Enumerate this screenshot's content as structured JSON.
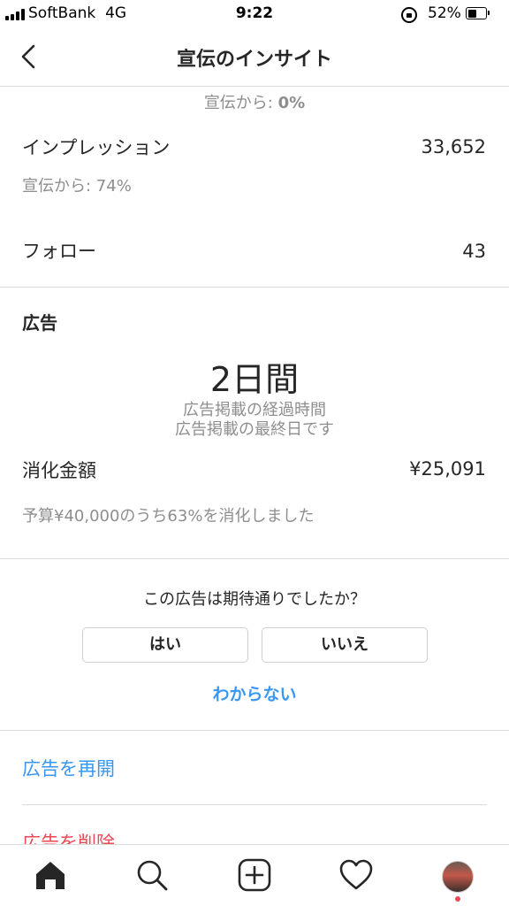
{
  "status_bar": {
    "carrier": "SoftBank",
    "network": "4G",
    "time": "9:22",
    "battery_percent": "52%",
    "battery_level": 0.52
  },
  "header": {
    "title": "宣伝のインサイト",
    "back_icon": "chevron-left-icon"
  },
  "metrics": {
    "top_partial": {
      "label": "宣伝から: ",
      "value": "0%"
    },
    "impressions": {
      "label": "インプレッション",
      "value": "33,652",
      "sub": "宣伝から: 74%"
    },
    "follows": {
      "label": "フォロー",
      "value": "43"
    }
  },
  "ad": {
    "section_title": "広告",
    "duration": "2日間",
    "duration_caption": "広告掲載の経過時間",
    "end_caption": "広告掲載の最終日です",
    "spend_label": "消化金額",
    "spend_value": "¥25,091",
    "budget_note": "予算¥40,000のうち63%を消化しました"
  },
  "feedback": {
    "question": "この広告は期待通りでしたか？",
    "yes": "はい",
    "no": "いいえ",
    "unsure": "わからない"
  },
  "actions": {
    "resume": "広告を再開",
    "delete": "広告を削除"
  },
  "colors": {
    "link_blue": "#3897f0",
    "delete_red": "#ed4956",
    "text_primary": "#262626",
    "text_muted": "#8e8e8e",
    "divider": "#dbdbdb"
  },
  "tab_bar": {
    "icons": [
      "home-icon",
      "search-icon",
      "new-post-icon",
      "activity-heart-icon",
      "profile-avatar"
    ]
  }
}
